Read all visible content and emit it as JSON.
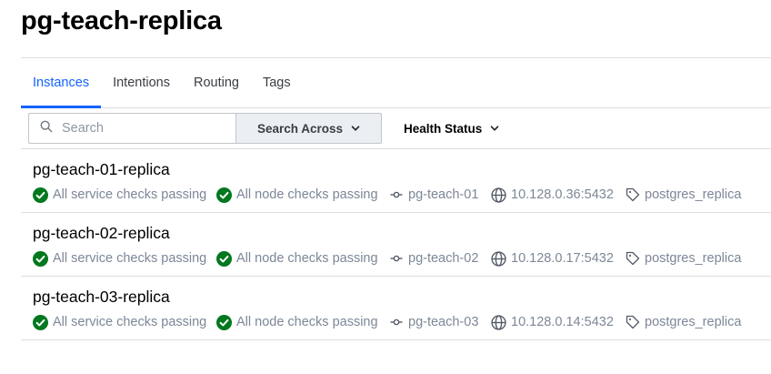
{
  "page": {
    "title": "pg-teach-replica"
  },
  "tabs": [
    {
      "label": "Instances",
      "active": true
    },
    {
      "label": "Intentions"
    },
    {
      "label": "Routing"
    },
    {
      "label": "Tags"
    }
  ],
  "filters": {
    "search_placeholder": "Search",
    "search_across_label": "Search Across",
    "health_status_label": "Health Status"
  },
  "colors": {
    "accent": "#1563ff",
    "passing": "#00781e",
    "muted": "#7c8797"
  },
  "instances": [
    {
      "name": "pg-teach-01-replica",
      "service_checks": "All service checks passing",
      "node_checks": "All node checks passing",
      "node": "pg-teach-01",
      "address": "10.128.0.36:5432",
      "tag": "postgres_replica"
    },
    {
      "name": "pg-teach-02-replica",
      "service_checks": "All service checks passing",
      "node_checks": "All node checks passing",
      "node": "pg-teach-02",
      "address": "10.128.0.17:5432",
      "tag": "postgres_replica"
    },
    {
      "name": "pg-teach-03-replica",
      "service_checks": "All service checks passing",
      "node_checks": "All node checks passing",
      "node": "pg-teach-03",
      "address": "10.128.0.14:5432",
      "tag": "postgres_replica"
    }
  ]
}
